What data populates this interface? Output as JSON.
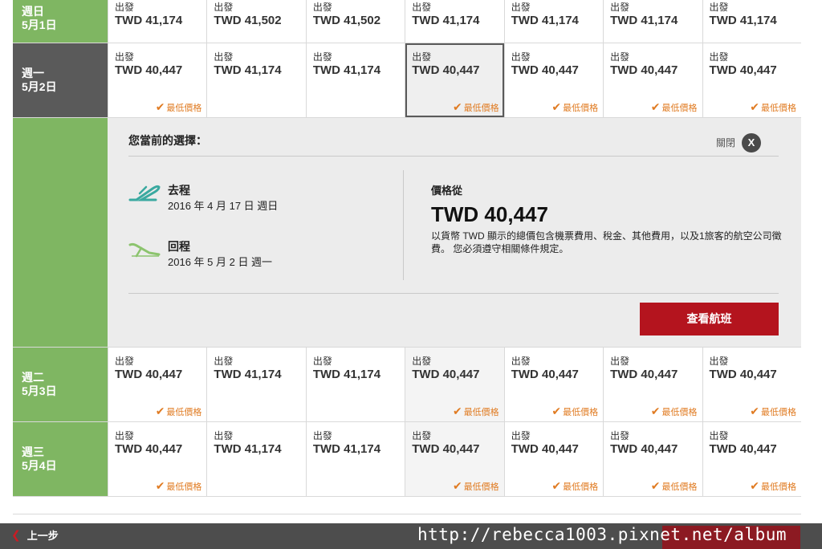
{
  "rows": [
    {
      "day": "週日",
      "date": "5月1日",
      "style": "green",
      "cells": [
        {
          "label": "出發",
          "price": "TWD 41,174"
        },
        {
          "label": "出發",
          "price": "TWD 41,502"
        },
        {
          "label": "出發",
          "price": "TWD 41,502"
        },
        {
          "label": "出發",
          "price": "TWD 41,174"
        },
        {
          "label": "出發",
          "price": "TWD 41,174"
        },
        {
          "label": "出發",
          "price": "TWD 41,174"
        },
        {
          "label": "出發",
          "price": "TWD 41,174"
        }
      ]
    },
    {
      "day": "週一",
      "date": "5月2日",
      "style": "dark",
      "cells": [
        {
          "label": "出發",
          "price": "TWD 40,447",
          "best": "最低價格"
        },
        {
          "label": "出發",
          "price": "TWD 41,174"
        },
        {
          "label": "出發",
          "price": "TWD 41,174"
        },
        {
          "label": "出發",
          "price": "TWD 40,447",
          "best": "最低價格",
          "selected": true
        },
        {
          "label": "出發",
          "price": "TWD 40,447",
          "best": "最低價格"
        },
        {
          "label": "出發",
          "price": "TWD 40,447",
          "best": "最低價格"
        },
        {
          "label": "出發",
          "price": "TWD 40,447",
          "best": "最低價格"
        }
      ]
    }
  ],
  "selection": {
    "title": "您當前的選擇：",
    "close_label": "關閉",
    "close_btn": "X",
    "outbound": {
      "name": "去程",
      "date": "2016 年 4 月 17 日 週日"
    },
    "inbound": {
      "name": "回程",
      "date": "2016 年 5 月 2 日 週一"
    },
    "price_from": "價格從",
    "price": "TWD 40,447",
    "note": "以貨幣 TWD 顯示的總價包含機票費用、稅金、其他費用，以及1旅客的航空公司徵費。 您必須遵守相關條件規定。",
    "view_button": "查看航班"
  },
  "rows_after": [
    {
      "day": "週二",
      "date": "5月3日",
      "style": "green",
      "cells": [
        {
          "label": "出發",
          "price": "TWD 40,447",
          "best": "最低價格"
        },
        {
          "label": "出發",
          "price": "TWD 41,174"
        },
        {
          "label": "出發",
          "price": "TWD 41,174"
        },
        {
          "label": "出發",
          "price": "TWD 40,447",
          "best": "最低價格",
          "shade": true
        },
        {
          "label": "出發",
          "price": "TWD 40,447",
          "best": "最低價格"
        },
        {
          "label": "出發",
          "price": "TWD 40,447",
          "best": "最低價格"
        },
        {
          "label": "出發",
          "price": "TWD 40,447",
          "best": "最低價格"
        }
      ]
    },
    {
      "day": "週三",
      "date": "5月4日",
      "style": "green",
      "cells": [
        {
          "label": "出發",
          "price": "TWD 40,447",
          "best": "最低價格"
        },
        {
          "label": "出發",
          "price": "TWD 41,174"
        },
        {
          "label": "出發",
          "price": "TWD 41,174"
        },
        {
          "label": "出發",
          "price": "TWD 40,447",
          "best": "最低價格",
          "shade": true
        },
        {
          "label": "出發",
          "price": "TWD 40,447",
          "best": "最低價格"
        },
        {
          "label": "出發",
          "price": "TWD 40,447",
          "best": "最低價格"
        },
        {
          "label": "出發",
          "price": "TWD 40,447",
          "best": "最低價格"
        }
      ]
    }
  ],
  "footer": {
    "back_label": "上一步",
    "watermark": "http://rebecca1003.pixnet.net/album"
  },
  "colors": {
    "green": "#7fb662",
    "dark": "#5a5a5a",
    "orange": "#e07b22",
    "red": "#b4141e"
  },
  "icons": {
    "check": "check-icon",
    "plane": "airplane-icon",
    "back": "chevron-left-icon",
    "close": "close-icon"
  }
}
